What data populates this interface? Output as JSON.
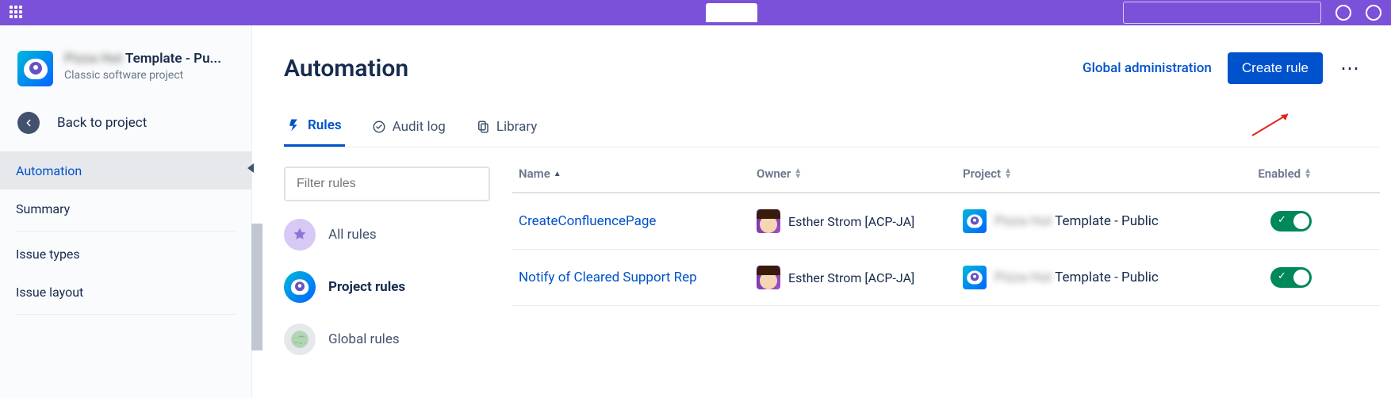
{
  "project": {
    "title_blur": "Pizza Hut",
    "title_rest": " Template - Pu...",
    "subtitle": "Classic software project"
  },
  "sidebar": {
    "back_label": "Back to project",
    "items": [
      "Automation",
      "Summary",
      "Issue types",
      "Issue layout"
    ],
    "active_index": 0
  },
  "header": {
    "title": "Automation",
    "global_admin": "Global administration",
    "create_button": "Create rule"
  },
  "tabs": [
    {
      "label": "Rules",
      "icon": "bolt-icon"
    },
    {
      "label": "Audit log",
      "icon": "clock-check-icon"
    },
    {
      "label": "Library",
      "icon": "copy-icon"
    }
  ],
  "active_tab": 0,
  "filter_placeholder": "Filter rules",
  "scopes": [
    {
      "label": "All rules"
    },
    {
      "label": "Project rules"
    },
    {
      "label": "Global rules"
    }
  ],
  "active_scope": 1,
  "columns": {
    "name": "Name",
    "owner": "Owner",
    "project": "Project",
    "enabled": "Enabled"
  },
  "rules": [
    {
      "name": "CreateConfluencePage",
      "owner": "Esther Strom [ACP-JA]",
      "project_blur": "Pizza Hut",
      "project_rest": " Template - Public",
      "enabled": true
    },
    {
      "name": "Notify of Cleared Support Rep",
      "owner": "Esther Strom [ACP-JA]",
      "project_blur": "Pizza Hut",
      "project_rest": " Template - Public",
      "enabled": true
    }
  ]
}
